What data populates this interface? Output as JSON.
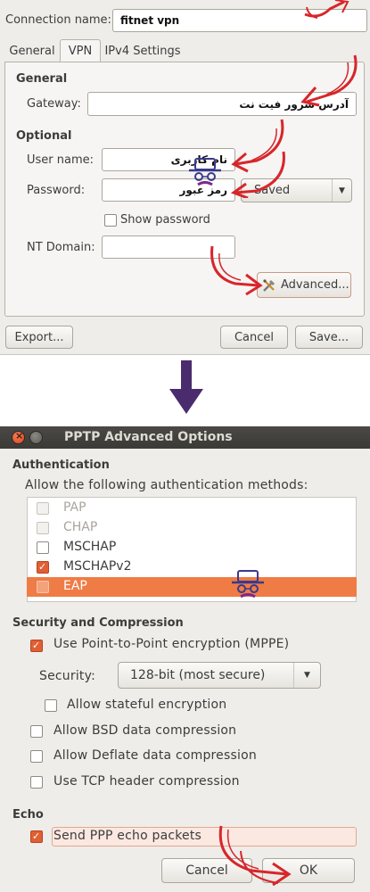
{
  "connection_editor": {
    "connection_name_label": "Connection name:",
    "connection_name_value": "fitnet vpn",
    "tabs": [
      {
        "label": "General"
      },
      {
        "label": "VPN"
      },
      {
        "label": "IPv4 Settings"
      }
    ],
    "general_heading": "General",
    "gateway_label": "Gateway:",
    "gateway_value": "آدرس سرور فیت نت",
    "optional_heading": "Optional",
    "user_name_label": "User name:",
    "user_name_value": "نام کاربری",
    "password_label": "Password:",
    "password_value": "رمز عبور",
    "password_storage_value": "Saved",
    "show_password_label": "Show password",
    "show_password_checked": false,
    "nt_domain_label": "NT Domain:",
    "nt_domain_value": "",
    "advanced_button": "Advanced...",
    "export_button": "Export...",
    "cancel_button": "Cancel",
    "save_button": "Save..."
  },
  "advanced_dialog": {
    "title": "PPTP Advanced Options",
    "authentication_heading": "Authentication",
    "allow_methods_label": "Allow the following authentication methods:",
    "auth_methods": [
      {
        "label": "PAP",
        "checked": false,
        "enabled": false
      },
      {
        "label": "CHAP",
        "checked": false,
        "enabled": false
      },
      {
        "label": "MSCHAP",
        "checked": false,
        "enabled": true
      },
      {
        "label": "MSCHAPv2",
        "checked": true,
        "enabled": true
      },
      {
        "label": "EAP",
        "checked": false,
        "enabled": true,
        "selected": true
      }
    ],
    "security_heading": "Security and Compression",
    "use_mppe_label": "Use Point-to-Point encryption (MPPE)",
    "use_mppe_checked": true,
    "security_label": "Security:",
    "security_value": "128-bit (most secure)",
    "stateful_label": "Allow stateful encryption",
    "bsd_label": "Allow BSD data compression",
    "deflate_label": "Allow Deflate data compression",
    "tcp_header_label": "Use TCP header compression",
    "echo_heading": "Echo",
    "echo_label": "Send PPP echo packets",
    "echo_checked": true,
    "cancel_button": "Cancel",
    "ok_button": "OK"
  },
  "colors": {
    "accent": "#e05f34",
    "annotation_red": "#d7262b",
    "arrow_purple": "#4a2c6e",
    "window_bg": "#efede9",
    "titlebar": "#3c3b37"
  }
}
